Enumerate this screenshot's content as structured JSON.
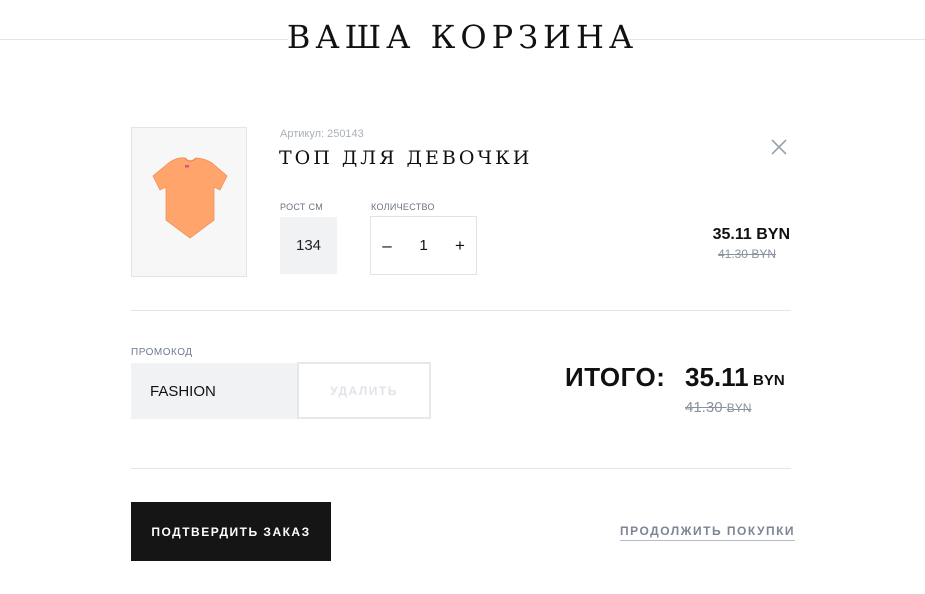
{
  "page": {
    "title": "ВАША КОРЗИНА"
  },
  "cart_item": {
    "article_label": "Артикул:",
    "article_number": "250143",
    "name": "ТОП ДЛЯ ДЕВОЧКИ",
    "image_icon": "orange-tshirt-image",
    "size_label": "РОСТ см",
    "size_value": "134",
    "quantity_label": "КОЛИЧЕСТВО",
    "quantity_minus": "–",
    "quantity_value": "1",
    "quantity_plus": "+",
    "price_current": "35.11 BYN",
    "price_old": "41.30 BYN",
    "remove_icon": "close-icon"
  },
  "promo": {
    "label": "ПРОМОКОД",
    "value": "FASHION",
    "remove_label": "УДАЛИТЬ"
  },
  "total": {
    "label": "ИТОГО:",
    "value": "35.11",
    "currency": "BYN",
    "old_value": "41.30",
    "old_currency": "BYN"
  },
  "actions": {
    "confirm_label": "ПОДТВЕРДИТЬ ЗАКАЗ",
    "continue_label": "ПРОДОЛЖИТЬ ПОКУПКИ"
  },
  "colors": {
    "primary_button": "#151515",
    "muted_text": "#8a929e",
    "product_orange": "#ffa56b"
  }
}
